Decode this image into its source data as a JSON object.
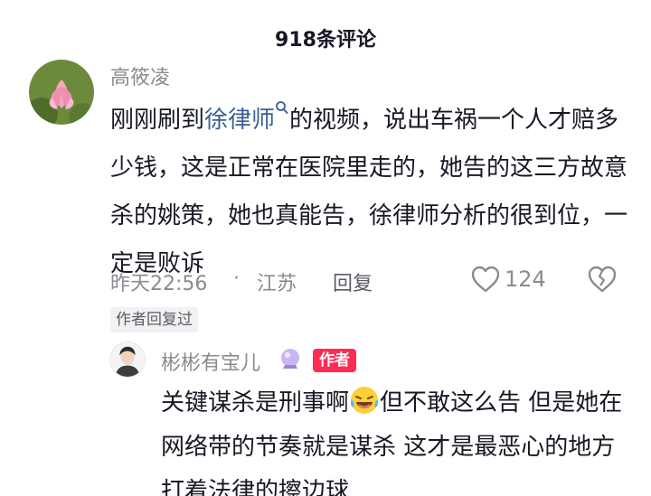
{
  "header": {
    "title": "918条评论"
  },
  "comment": {
    "username": "高筱凌",
    "text_before": "刚刚刷到",
    "mention": "徐律师",
    "mention_icon": "search-icon",
    "text_after": "的视频，说出车祸一个人才赔多少钱，这是正常在医院里走的，她告的这三方故意杀的姚策，她也真能告，徐律师分析的很到位，一定是败诉",
    "time": "昨天22:56",
    "separator": "·",
    "location": "江苏",
    "reply_label": "回复",
    "like_count": "124",
    "author_replied_tag": "作者回复过"
  },
  "reply": {
    "username": "彬彬有宝儿",
    "username_emoji": "crystal-ball-icon",
    "author_badge": "作者",
    "text_before": "关键谋杀是刑事啊",
    "emoji": "laughing-crying-emoji",
    "text_after": "但不敢这么告 但是她在网络带的节奏就是谋杀 这才是最恶心的地方 打着法律的擦边球"
  },
  "colors": {
    "mention": "#3a5e95",
    "secondary_text": "#8a8b91",
    "author_badge_bg": "#fe2c55",
    "primary_text": "#161823"
  }
}
